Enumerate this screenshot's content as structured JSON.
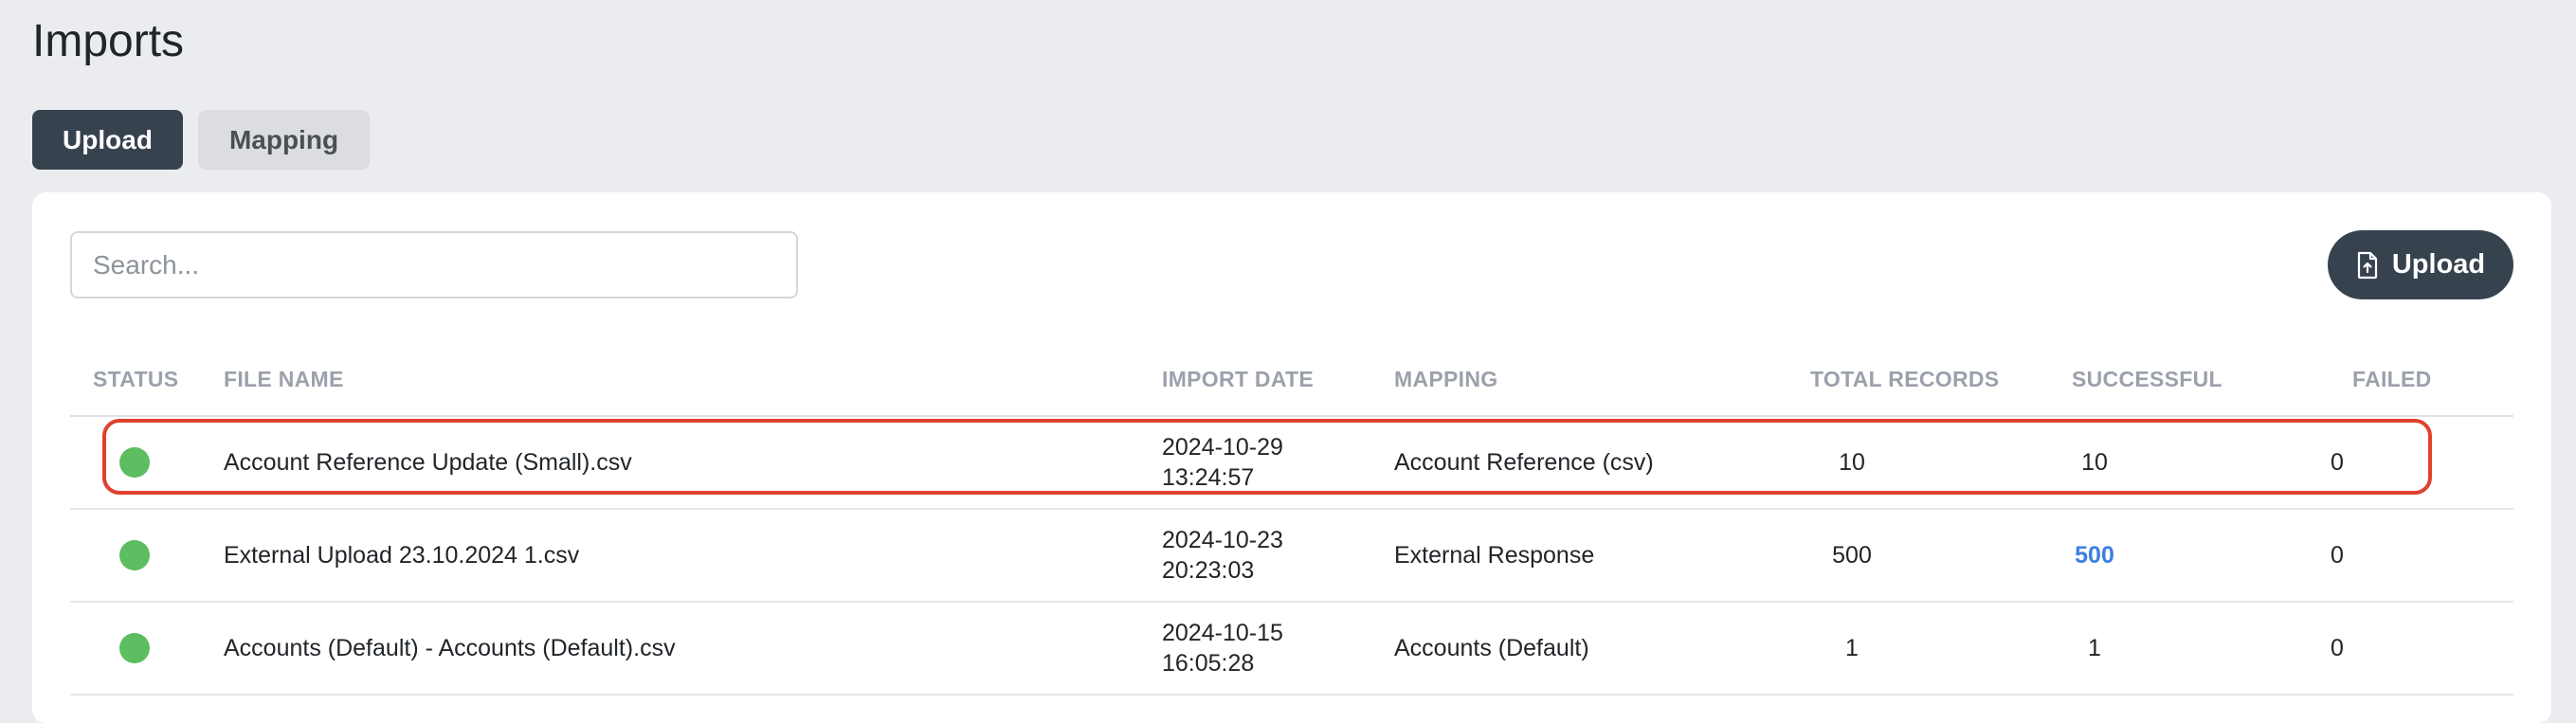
{
  "page": {
    "title": "Imports"
  },
  "tabs": [
    {
      "label": "Upload",
      "active": true
    },
    {
      "label": "Mapping",
      "active": false
    }
  ],
  "search": {
    "placeholder": "Search...",
    "value": ""
  },
  "toolbar": {
    "upload_label": "Upload",
    "upload_icon": "file-upload-icon"
  },
  "table": {
    "headers": {
      "status": "STATUS",
      "file_name": "FILE NAME",
      "import_date": "IMPORT DATE",
      "mapping": "MAPPING",
      "total_records": "TOTAL RECORDS",
      "successful": "SUCCESSFUL",
      "failed": "FAILED"
    },
    "rows": [
      {
        "status": "success",
        "file_name": "Account Reference Update (Small).csv",
        "date": "2024-10-29",
        "time": "13:24:57",
        "mapping": "Account Reference (csv)",
        "total_records": "10",
        "successful": "10",
        "failed": "0"
      },
      {
        "status": "success",
        "file_name": "External Upload 23.10.2024 1.csv",
        "date": "2024-10-23",
        "time": "20:23:03",
        "mapping": "External Response",
        "total_records": "500",
        "successful": "500",
        "failed": "0"
      },
      {
        "status": "success",
        "file_name": "Accounts (Default) - Accounts (Default).csv",
        "date": "2024-10-15",
        "time": "16:05:28",
        "mapping": "Accounts (Default)",
        "total_records": "1",
        "successful": "1",
        "failed": "0"
      }
    ]
  },
  "colors": {
    "background": "#ebecf0",
    "primary_dark": "#37424f",
    "status_success": "#5cbd61",
    "link_blue": "#3d7fe0",
    "highlight_red": "#e0412e"
  }
}
